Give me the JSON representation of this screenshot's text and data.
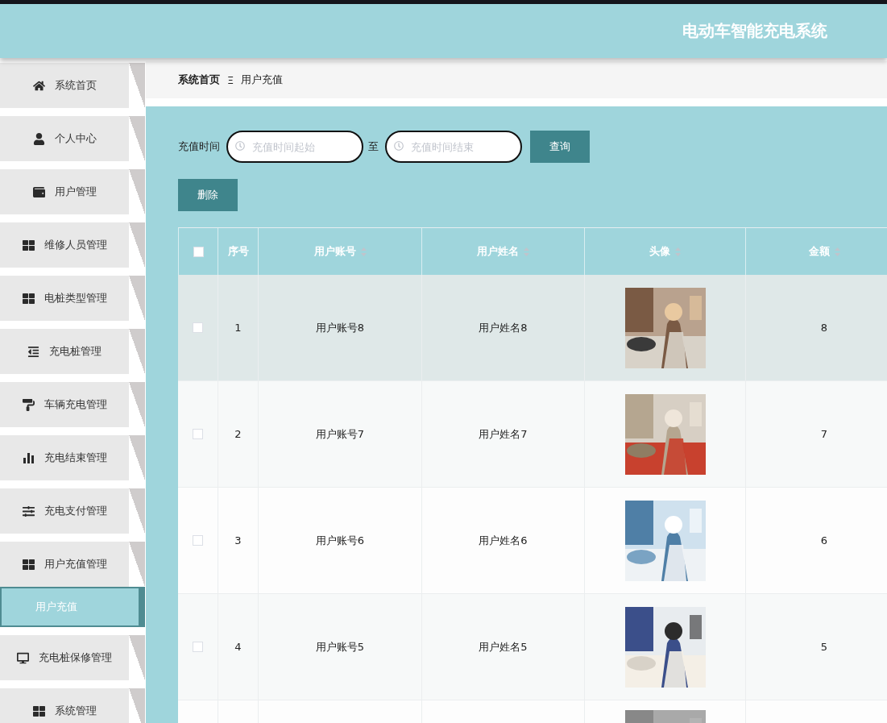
{
  "header": {
    "title": "电动车智能充电系统"
  },
  "sidebar": {
    "items": [
      {
        "label": "系统首页"
      },
      {
        "label": "个人中心"
      },
      {
        "label": "用户管理"
      },
      {
        "label": "维修人员管理"
      },
      {
        "label": "电桩类型管理"
      },
      {
        "label": "充电桩管理"
      },
      {
        "label": "车辆充电管理"
      },
      {
        "label": "充电结束管理"
      },
      {
        "label": "充电支付管理"
      },
      {
        "label": "用户充值管理",
        "children": [
          {
            "label": "用户充值",
            "selected": true
          }
        ]
      },
      {
        "label": "充电桩保修管理"
      },
      {
        "label": "系统管理"
      }
    ]
  },
  "breadcrumb": {
    "items": [
      "系统首页",
      "用户充值"
    ],
    "separator": "Ξ"
  },
  "filter": {
    "label": "充值时间",
    "start_placeholder": "充值时间起始",
    "between": "至",
    "end_placeholder": "充值时间结束",
    "search_button": "查询"
  },
  "delete_button": "删除",
  "table": {
    "header_checked": false,
    "columns": [
      "序号",
      "用户账号",
      "用户姓名",
      "头像",
      "金额"
    ],
    "rows": [
      {
        "checked": false,
        "highlighted": true,
        "index": "1",
        "account": "用户账号8",
        "name": "用户姓名8",
        "avatar": {
          "kind": "picture"
        },
        "amount": "8"
      },
      {
        "checked": false,
        "highlighted": false,
        "index": "2",
        "account": "用户账号7",
        "name": "用户姓名7",
        "avatar": {
          "kind": "picture"
        },
        "amount": "7"
      },
      {
        "checked": false,
        "highlighted": false,
        "index": "3",
        "account": "用户账号6",
        "name": "用户姓名6",
        "avatar": {
          "kind": "picture"
        },
        "amount": "6"
      },
      {
        "checked": false,
        "highlighted": false,
        "index": "4",
        "account": "用户账号5",
        "name": "用户姓名5",
        "avatar": {
          "kind": "picture"
        },
        "amount": "5"
      },
      {
        "avatar": {
          "kind": "picture"
        }
      }
    ]
  }
}
